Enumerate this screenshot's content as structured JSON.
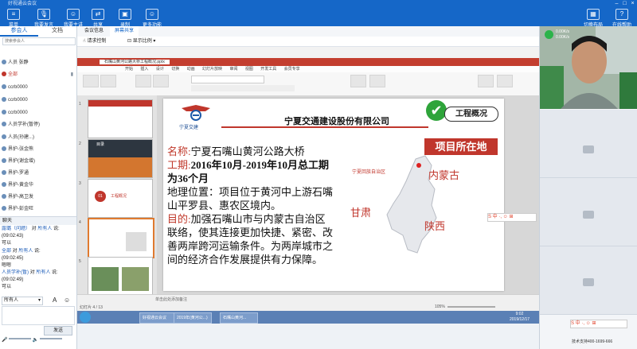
{
  "app": {
    "title": "好视通云会议",
    "toolbar_left": [
      {
        "label": "菜单",
        "icon": "menu-icon"
      },
      {
        "label": "我要发言",
        "icon": "mic-icon"
      },
      {
        "label": "我要主讲",
        "icon": "speaker-icon"
      },
      {
        "label": "共享",
        "icon": "share-icon"
      },
      {
        "label": "录制",
        "icon": "record-icon"
      },
      {
        "label": "更多功能",
        "icon": "more-icon"
      }
    ],
    "toolbar_right": [
      {
        "label": "切换布局",
        "icon": "layout-icon"
      },
      {
        "label": "在线帮助",
        "icon": "help-icon"
      }
    ]
  },
  "left_panel": {
    "tabs": [
      "参会人",
      "文档"
    ],
    "search_placeholder": "搜索参会人",
    "participants": [
      {
        "name": "人员 张静",
        "status": ""
      },
      {
        "name": "全部",
        "status": ""
      },
      {
        "name": "ccrb0000",
        "status": ""
      },
      {
        "name": "ccrb0000",
        "status": ""
      },
      {
        "name": "ccrb0000",
        "status": ""
      },
      {
        "name": "人员学补(暂停)",
        "status": ""
      },
      {
        "name": "人员(孙建...)",
        "status": ""
      },
      {
        "name": "界护-张金熊",
        "status": ""
      },
      {
        "name": "界护(谢金增)",
        "status": ""
      },
      {
        "name": "界护-罗通",
        "status": ""
      },
      {
        "name": "界护-黄金华",
        "status": ""
      },
      {
        "name": "界护-高卫发",
        "status": ""
      },
      {
        "name": "界护-彭金旺",
        "status": ""
      },
      {
        "name": "界护(黎金强)",
        "status": ""
      }
    ],
    "chat_title": "聊天",
    "chat": [
      {
        "from": "露璐（问题）",
        "to": "所有人",
        "time": "(09:02:43)",
        "text": "可以"
      },
      {
        "from": "全部",
        "to": "所有人",
        "time": "(09:02:45)",
        "text": "嗯嗯"
      },
      {
        "from": "人员学补(暂)",
        "to": "所有人",
        "time": "(09:02:49)",
        "text": "可以"
      }
    ],
    "chat_target": "所有人",
    "send_label": "发送"
  },
  "mid": {
    "tabs": [
      "会议信息",
      "屏幕共享",
      "显示比例"
    ],
    "tool_items": [
      "请求控制",
      "显示比例"
    ]
  },
  "ppt": {
    "doc_tab": "石嘴山黄河公路大桥工程概况.pptx",
    "menu": [
      "开始",
      "插入",
      "设计",
      "切换",
      "动画",
      "幻灯片放映",
      "审阅",
      "视图",
      "开发工具",
      "会员专享"
    ],
    "slide_count": "幻灯片 4 / 13",
    "zoom": "105%",
    "notes_placeholder": "单击此处添加备注",
    "thumb_numbers": [
      "1",
      "2",
      "3",
      "4",
      "5"
    ],
    "thumb_labels": [
      "目录",
      "工程概况",
      "",
      "",
      ""
    ]
  },
  "slide": {
    "company": "宁夏交通建设股份有限公司",
    "logo_text": "宁夏交建",
    "badge": "工程概况",
    "lines": [
      {
        "label": "名称:",
        "text": "宁夏石嘴山黄河公路大桥"
      },
      {
        "label": "工期:",
        "text": "2016年10月-2019年10月总工期为36个月"
      },
      {
        "label": "",
        "text": "地理位置：项目位于黄河中上游石嘴山平罗县、惠农区境内。"
      },
      {
        "label": "目的:",
        "text": "加强石嘴山市与内蒙古自治区联络，使其连接更加快捷、紧密、改善两岸跨河运输条件。为两岸城市之间的经济合作发展提供有力保障。"
      }
    ],
    "map_title": "项目所在地",
    "map_labels": [
      "宁夏回族自治区",
      "内蒙古",
      "甘肃",
      "陕西"
    ]
  },
  "taskbar": {
    "items": [
      "好视通云会议",
      "2019年(黄河公...)",
      "石嘴山黄河..."
    ],
    "clock": "9:02",
    "date": "2019/12/17"
  },
  "right_panel": {
    "signal": "0.00K/s",
    "signal2": "0.00K/s",
    "support": "技术支持400-1699-666"
  },
  "colors": {
    "accent": "#1567c8",
    "slide_red": "#c0362c",
    "slide_label": "#c0392b"
  }
}
